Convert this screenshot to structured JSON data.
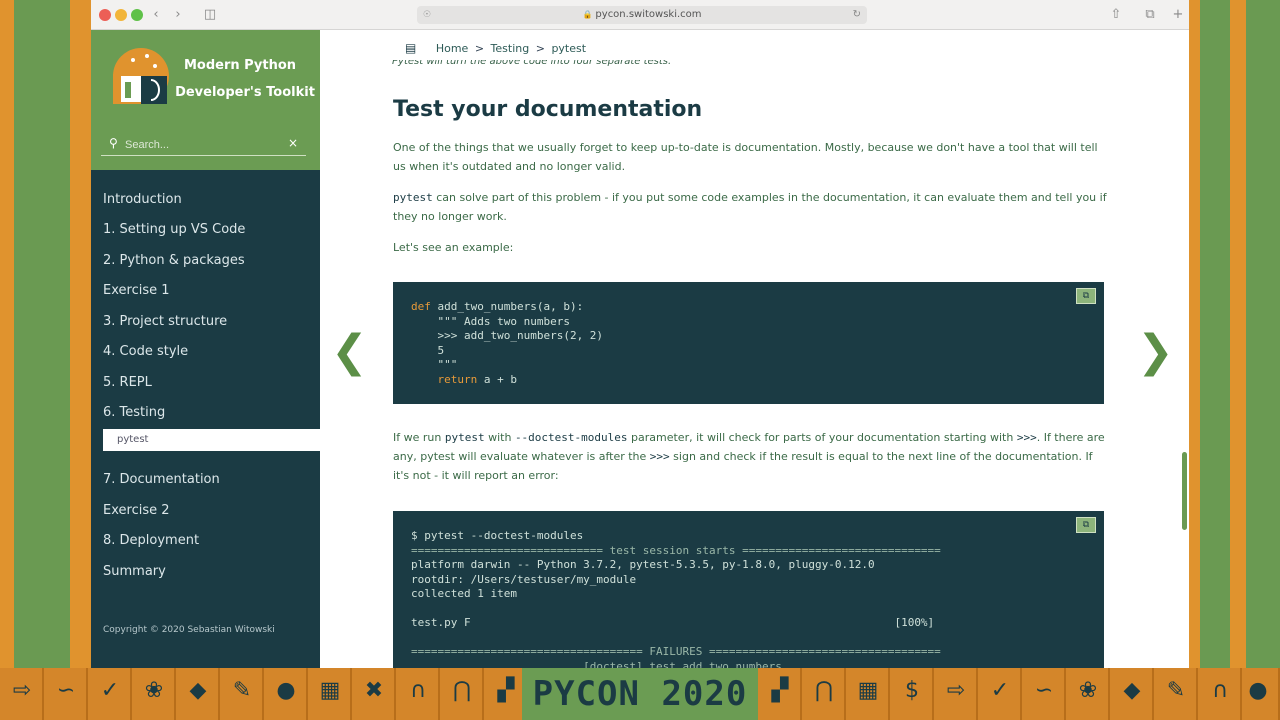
{
  "browser": {
    "url": "pycon.switowski.com"
  },
  "brand": {
    "line1": "Modern Python",
    "line2": "Developer's Toolkit"
  },
  "search": {
    "placeholder": "Search..."
  },
  "nav": {
    "items": [
      "Introduction",
      "1. Setting up VS Code",
      "2. Python & packages",
      "Exercise 1",
      "3. Project structure",
      "4. Code style",
      "5. REPL",
      "6. Testing",
      "pytest",
      "7. Documentation",
      "Exercise 2",
      "8. Deployment",
      "Summary"
    ],
    "active": "pytest",
    "copyright": "Copyright © 2020 Sebastian Witowski"
  },
  "breadcrumb": {
    "home": "Home",
    "sep": ">",
    "section": "Testing",
    "current": "pytest"
  },
  "content": {
    "cutoff_line": "Pytest will turn the above code into four separate tests.",
    "heading": "Test your documentation",
    "p1": "One of the things that we usually forget to keep up-to-date is documentation. Mostly, because we don't have a tool that will tell us when it's outdated and no longer valid.",
    "p2_code": "pytest",
    "p2_text": " can solve part of this problem - if you put some code examples in the documentation, it can evaluate them and tell you if they no longer work.",
    "p3": "Let's see an example:",
    "code1": {
      "l1_kw": "def",
      "l1_rest": " add_two_numbers(a, b):",
      "l2": "    \"\"\" Adds two numbers",
      "l3": "    >>> add_two_numbers(2, 2)",
      "l4": "    5",
      "l5": "    \"\"\"",
      "l6_kw": "    return",
      "l6_rest": " a + b"
    },
    "p4_a": "If we run ",
    "p4_code1": "pytest",
    "p4_b": " with ",
    "p4_code2": "--doctest-modules",
    "p4_c": " parameter, it will check for parts of your documentation starting with ",
    "p4_code3": ">>>",
    "p4_d": ". If there are any, pytest will evaluate whatever is after the ",
    "p4_code4": ">>>",
    "p4_e": " sign and check if the result is equal to the next line of the documentation. If it's not - it will report an error:",
    "code2": {
      "l1": "$ pytest --doctest-modules",
      "l2": "============================= test session starts ==============================",
      "l3": "platform darwin -- Python 3.7.2, pytest-5.3.5, py-1.8.0, pluggy-0.12.0",
      "l4": "rootdir: /Users/testuser/my_module",
      "l5": "collected 1 item",
      "l6": "",
      "l7": "test.py F                                                                [100%]",
      "l8": "",
      "l9": "=================================== FAILURES ===================================",
      "l10": "_________________________ [doctest] test.add_two_numbers _________________________"
    }
  },
  "banner": {
    "title": "PYCON 2020"
  },
  "colors": {
    "sidebar_bg": "#1b3b44",
    "brand_bg": "#6b9c53",
    "accent_green": "#6a9a52",
    "orange": "#e0932e"
  }
}
